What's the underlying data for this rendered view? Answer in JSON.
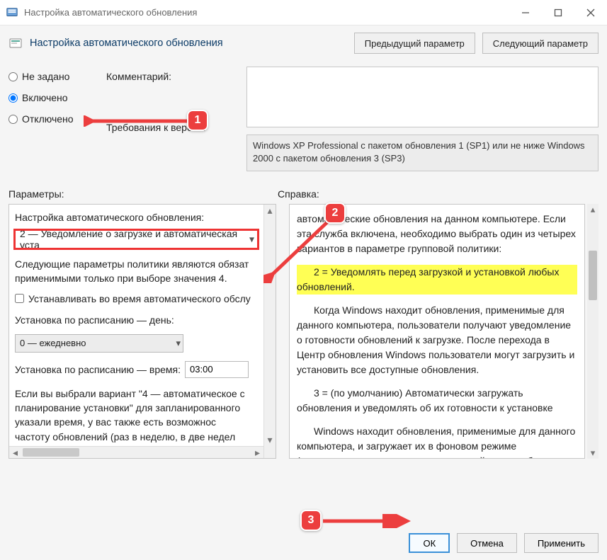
{
  "window": {
    "title": "Настройка автоматического обновления"
  },
  "header": {
    "policy_title": "Настройка автоматического обновления",
    "prev_btn": "Предыдущий параметр",
    "next_btn": "Следующий параметр"
  },
  "radios": {
    "not_configured": "Не задано",
    "enabled": "Включено",
    "disabled": "Отключено",
    "selected": "enabled"
  },
  "labels": {
    "comment": "Комментарий:",
    "requirements": "Требования к версии:"
  },
  "requirements_text": "Windows XP Professional с пакетом обновления 1 (SP1) или не ниже Windows 2000 с пакетом обновления 3 (SP3)",
  "sections": {
    "params": "Параметры:",
    "help": "Справка:"
  },
  "params_pane": {
    "config_label": "Настройка автоматического обновления:",
    "config_value": "2 — Уведомление о загрузке и автоматическая уста",
    "following_text": "Следующие параметры политики являются обязат\nприменимыми только при выборе значения 4.",
    "checkbox_label": "Устанавливать во время автоматического обслу",
    "schedule_day_label": "Установка по расписанию — день:",
    "schedule_day_value": "0 — ежедневно",
    "schedule_time_label": "Установка по расписанию — время:",
    "schedule_time_value": "03:00",
    "bottom_text": "Если вы выбрали вариант \"4 — автоматическое с\nпланирование установки\" для запланированного\nуказали время, у вас также есть возможнос\nчастоту обновлений (раз в неделю, в две недел\nуказанные варианты описанные ниже"
  },
  "help_pane": {
    "p1": "автоматические обновления на данном компьютере. Если эта служба включена, необходимо выбрать один из четырех вариантов в параметре групповой политики:",
    "hl": "2 = Уведомлять перед загрузкой и установкой любых обновлений.",
    "p2": "Когда Windows находит обновления, применимые для данного компьютера, пользователи получают уведомление о готовности обновлений к загрузке. После перехода в Центр обновления Windows пользователи могут загрузить и установить все доступные обновления.",
    "p3": "3 = (по умолчанию) Автоматически загружать обновления и уведомлять об их готовности к установке",
    "p4": "Windows находит обновления, применимые для данного компьютера, и загружает их в фоновом режиме (пользователь не получает уведомлений, и его работа при этом не"
  },
  "footer": {
    "ok": "ОК",
    "cancel": "Отмена",
    "apply": "Применить"
  },
  "markers": {
    "m1": "1",
    "m2": "2",
    "m3": "3"
  }
}
